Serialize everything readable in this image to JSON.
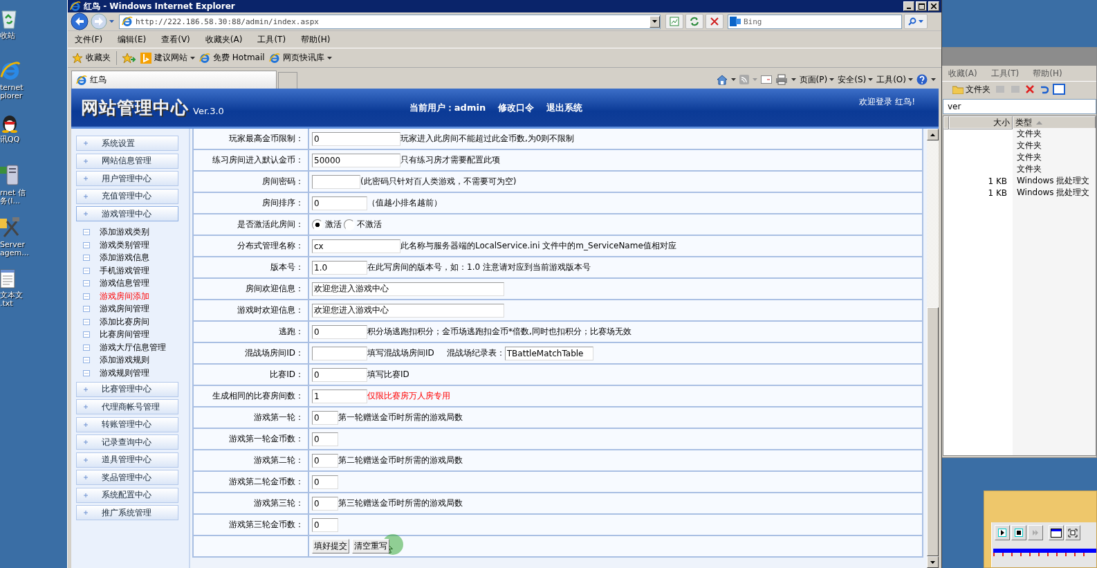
{
  "desktop_icons": [
    {
      "lines": [
        "收站"
      ]
    },
    {
      "lines": [
        "ternet",
        "plorer"
      ]
    },
    {
      "lines": [
        "讯QQ"
      ]
    },
    {
      "lines": [
        "rnet 信",
        "务(I..."
      ]
    },
    {
      "lines": [
        "Server",
        "agem..."
      ]
    },
    {
      "lines": [
        "文本文",
        ".txt"
      ]
    }
  ],
  "explorer": {
    "menu": [
      "收藏(A)",
      "工具(T)",
      "帮助(H)"
    ],
    "toolbar_label": "文件夹",
    "address": "ver",
    "columns": [
      "大小",
      "类型"
    ],
    "rows": [
      {
        "type": "文件夹"
      },
      {
        "type": "文件夹"
      },
      {
        "type": "文件夹"
      },
      {
        "type": "文件夹"
      },
      {
        "size": "1 KB",
        "type": "Windows 批处理文"
      },
      {
        "size": "1 KB",
        "type": "Windows 批处理文"
      }
    ]
  },
  "browser": {
    "title": "红鸟 - Windows Internet Explorer",
    "address": "http://222.186.58.30:88/admin/index.aspx",
    "search_placeholder": "Bing",
    "menu": [
      "文件(F)",
      "编辑(E)",
      "查看(V)",
      "收藏夹(A)",
      "工具(T)",
      "帮助(H)"
    ],
    "favorites_label": "收藏夹",
    "favorites": [
      {
        "label": "建议网站",
        "dropdown": true
      },
      {
        "label": "免费 Hotmail",
        "dropdown": false
      },
      {
        "label": "网页快讯库",
        "dropdown": true
      }
    ],
    "tab": "红鸟",
    "commands": [
      "页面(P)",
      "安全(S)",
      "工具(O)"
    ]
  },
  "site": {
    "logo": "网站管理中心",
    "version": "Ver.3.0",
    "current_user": "当前用户：admin",
    "links": [
      "修改口令",
      "退出系统"
    ],
    "welcome": "欢迎登录 红鸟!"
  },
  "sidebar": {
    "items": [
      {
        "label": "系统设置",
        "expanded": false
      },
      {
        "label": "网站信息管理",
        "expanded": false
      },
      {
        "label": "用户管理中心",
        "expanded": false
      },
      {
        "label": "充值管理中心",
        "expanded": false
      },
      {
        "label": "游戏管理中心",
        "expanded": true,
        "children": [
          {
            "label": "添加游戏类别",
            "selected": false
          },
          {
            "label": "游戏类别管理",
            "selected": false
          },
          {
            "label": "添加游戏信息",
            "selected": false
          },
          {
            "label": "手机游戏管理",
            "selected": false
          },
          {
            "label": "游戏信息管理",
            "selected": false
          },
          {
            "label": "游戏房间添加",
            "selected": true
          },
          {
            "label": "游戏房间管理",
            "selected": false
          },
          {
            "label": "添加比赛房间",
            "selected": false
          },
          {
            "label": "比赛房间管理",
            "selected": false
          },
          {
            "label": "游戏大厅信息管理",
            "selected": false
          },
          {
            "label": "添加游戏规则",
            "selected": false
          },
          {
            "label": "游戏规则管理",
            "selected": false
          }
        ]
      },
      {
        "label": "比赛管理中心",
        "expanded": false
      },
      {
        "label": "代理商帐号管理",
        "expanded": false
      },
      {
        "label": "转账管理中心",
        "expanded": false
      },
      {
        "label": "记录查询中心",
        "expanded": false
      },
      {
        "label": "道具管理中心",
        "expanded": false
      },
      {
        "label": "奖品管理中心",
        "expanded": false
      },
      {
        "label": "系统配置中心",
        "expanded": false
      },
      {
        "label": "推广系统管理",
        "expanded": false
      }
    ]
  },
  "form": {
    "rows": [
      {
        "kind": "text",
        "label": "玩家最高金币限制：",
        "value": "0",
        "hint": "玩家进入此房间不能超过此金币数,为0则不限制",
        "warning": false
      },
      {
        "kind": "text",
        "label": "练习房间进入默认金币：",
        "value": "50000",
        "hint": "只有练习房才需要配置此项",
        "warning": false
      },
      {
        "kind": "text",
        "label": "房间密码：",
        "hint": "(此密码只针对百人类游戏，不需要可为空)",
        "warning": false
      },
      {
        "kind": "text",
        "label": "房间排序：",
        "value": "0",
        "hint": "（值越小排名越前）",
        "warning": false
      },
      {
        "kind": "radio",
        "label": "是否激活此房间：",
        "options": [
          {
            "label": "激活",
            "selected": true
          },
          {
            "label": "不激活",
            "selected": false
          }
        ]
      },
      {
        "kind": "text",
        "label": "分布式管理名称：",
        "value": "cx",
        "hint": "此名称与服务器端的LocalService.ini 文件中的m_ServiceName值相对应",
        "warning": false
      },
      {
        "kind": "text",
        "label": "版本号：",
        "value": "1.0",
        "hint": "在此写房间的版本号，如：1.0 注意请对应到当前游戏版本号",
        "warning": false
      },
      {
        "kind": "text",
        "label": "房间欢迎信息：",
        "value": "欢迎您进入游戏中心"
      },
      {
        "kind": "text",
        "label": "游戏时欢迎信息：",
        "value": "欢迎您进入游戏中心"
      },
      {
        "kind": "text",
        "label": "逃跑：",
        "value": "0",
        "hint": "积分场逃跑扣积分；金币场逃跑扣金币*倍数,同时也扣积分；比赛场无效",
        "warning": false
      },
      {
        "kind": "pair",
        "label": "混战场房间ID：",
        "hint": "填写混战场房间ID",
        "warning": false,
        "second_label": "混战场纪录表：",
        "second_value": "TBattleMatchTable"
      },
      {
        "kind": "text",
        "label": "比赛ID：",
        "value": "0",
        "hint": "填写比赛ID",
        "warning": false
      },
      {
        "kind": "text",
        "label": "生成相同的比赛房间数：",
        "value": "1",
        "hint": "仅限比赛房万人房专用",
        "warning": true
      },
      {
        "kind": "text",
        "label": "游戏第一轮：",
        "value": "0",
        "hint": "第一轮赠送金币时所需的游戏局数",
        "warning": false
      },
      {
        "kind": "text",
        "label": "游戏第一轮金币数：",
        "value": "0"
      },
      {
        "kind": "text",
        "label": "游戏第二轮：",
        "value": "0",
        "hint": "第二轮赠送金币时所需的游戏局数",
        "warning": false
      },
      {
        "kind": "text",
        "label": "游戏第二轮金币数：",
        "value": "0"
      },
      {
        "kind": "text",
        "label": "游戏第三轮：",
        "value": "0",
        "hint": "第三轮赠送金币时所需的游戏局数",
        "warning": false
      },
      {
        "kind": "text",
        "label": "游戏第三轮金币数：",
        "value": "0"
      },
      {
        "kind": "buttons",
        "buttons": [
          "填好提交",
          "清空重写"
        ]
      }
    ]
  }
}
